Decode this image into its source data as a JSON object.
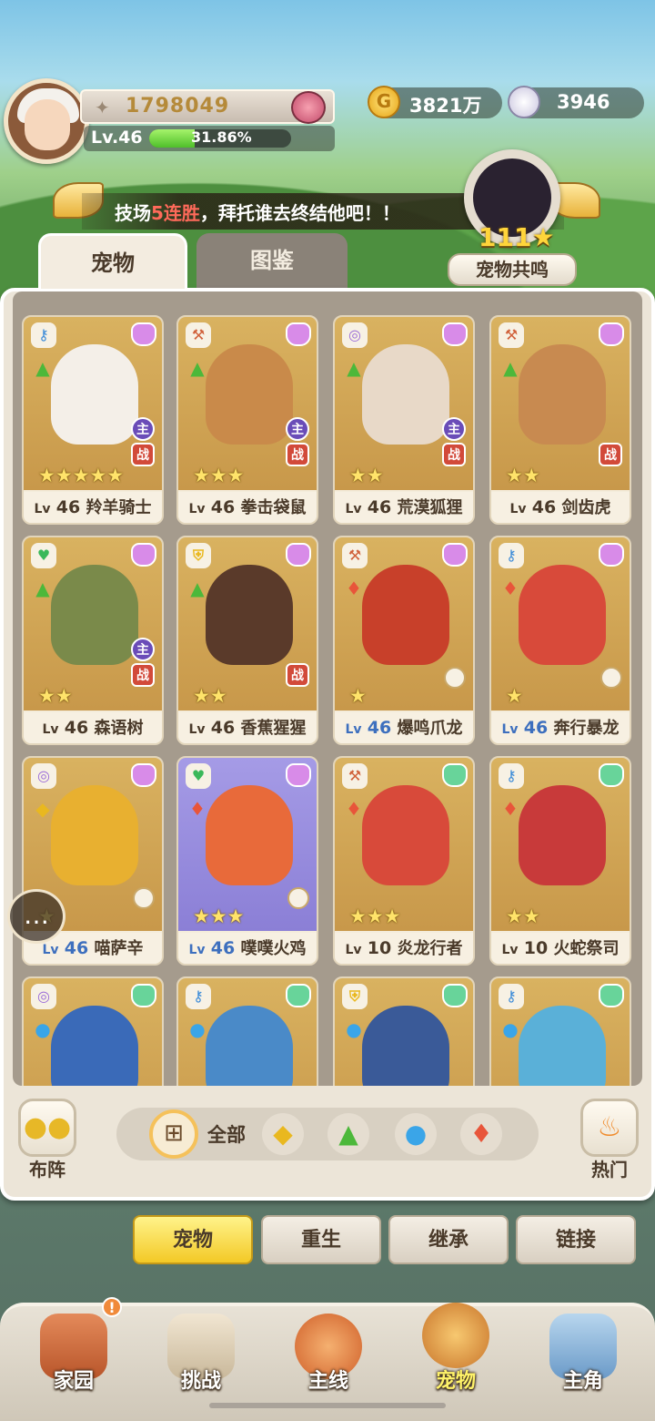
{
  "player": {
    "power": "1798049",
    "level": "Lv.46",
    "exp_percent": "31.86%",
    "exp_fraction": 0.3186
  },
  "currency": {
    "gold": "3821万",
    "shell": "3946"
  },
  "banner": {
    "prefix": "技场",
    "highlight": "5连胜",
    "suffix": "，拜托谁去终结他吧！！"
  },
  "resonance": {
    "count": "111",
    "label": "宠物共鸣"
  },
  "tabs": {
    "pets": "宠物",
    "book": "图鉴"
  },
  "pets": [
    {
      "lv_label": "Lv",
      "level": "46",
      "name": "羚羊骑士",
      "stars": "★★★★★",
      "role": "主",
      "battle": "战",
      "blue": false,
      "type_icon": "key-icon",
      "element": "grass"
    },
    {
      "lv_label": "Lv",
      "level": "46",
      "name": "拳击袋鼠",
      "stars": "★★★",
      "role": "主",
      "battle": "战",
      "blue": false,
      "type_icon": "axe-icon",
      "element": "grass"
    },
    {
      "lv_label": "Lv",
      "level": "46",
      "name": "荒漠狐狸",
      "stars": "★★",
      "role": "主",
      "battle": "战",
      "blue": false,
      "type_icon": "swirl-icon",
      "element": "grass"
    },
    {
      "lv_label": "Lv",
      "level": "46",
      "name": "剑齿虎",
      "stars": "★★",
      "role": "",
      "battle": "战",
      "blue": false,
      "type_icon": "axe-icon",
      "element": "grass"
    },
    {
      "lv_label": "Lv",
      "level": "46",
      "name": "森语树",
      "stars": "★★",
      "role": "主",
      "battle": "战",
      "blue": false,
      "type_icon": "heart-icon",
      "element": "grass"
    },
    {
      "lv_label": "Lv",
      "level": "46",
      "name": "香蕉猩猩",
      "stars": "★★",
      "role": "",
      "battle": "战",
      "blue": false,
      "type_icon": "shield-icon",
      "element": "grass"
    },
    {
      "lv_label": "Lv",
      "level": "46",
      "name": "爆鸣爪龙",
      "stars": "★",
      "role": "",
      "battle": "",
      "blue": true,
      "type_icon": "axe-icon",
      "element": "fire"
    },
    {
      "lv_label": "Lv",
      "level": "46",
      "name": "奔行暴龙",
      "stars": "★",
      "role": "",
      "battle": "",
      "blue": true,
      "type_icon": "key-icon",
      "element": "fire"
    },
    {
      "lv_label": "Lv",
      "level": "46",
      "name": "喵萨辛",
      "stars": "★",
      "role": "",
      "battle": "",
      "blue": true,
      "type_icon": "swirl-icon",
      "element": "rock"
    },
    {
      "lv_label": "Lv",
      "level": "46",
      "name": "噗噗火鸡",
      "stars": "★★★",
      "role": "",
      "battle": "",
      "blue": true,
      "type_icon": "heart-icon",
      "element": "fire"
    },
    {
      "lv_label": "Lv",
      "level": "10",
      "name": "炎龙行者",
      "stars": "★★★",
      "role": "",
      "battle": "",
      "blue": false,
      "type_icon": "axe-icon",
      "element": "fire"
    },
    {
      "lv_label": "Lv",
      "level": "10",
      "name": "火蛇祭司",
      "stars": "★★",
      "role": "",
      "battle": "",
      "blue": false,
      "type_icon": "key-icon",
      "element": "fire"
    },
    {
      "type_icon": "swirl-icon",
      "element": "water"
    },
    {
      "type_icon": "key-icon",
      "element": "water"
    },
    {
      "type_icon": "shield-icon",
      "element": "water"
    },
    {
      "type_icon": "key-icon",
      "element": "water"
    }
  ],
  "controls": {
    "formation": "布阵",
    "all": "全部",
    "hot": "热门"
  },
  "subtabs": [
    "宠物",
    "重生",
    "继承",
    "链接"
  ],
  "nav": [
    "家园",
    "挑战",
    "主线",
    "宠物",
    "主角"
  ],
  "alert": "!"
}
